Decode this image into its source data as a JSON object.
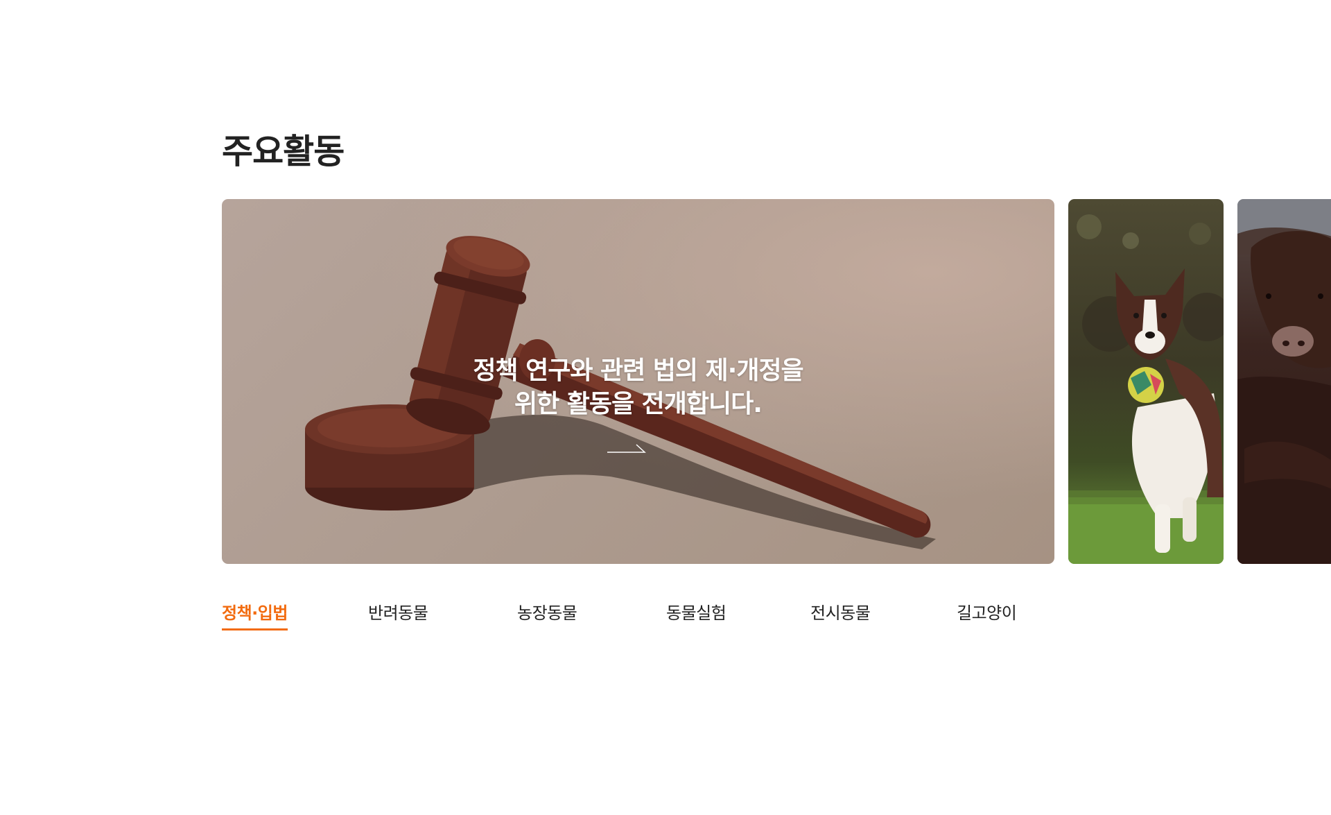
{
  "section": {
    "title": "주요활동"
  },
  "slides": [
    {
      "caption_line1": "정책 연구와 관련 법의 제·개정을",
      "caption_line2": "위한 활동을 전개합니다.",
      "image": "gavel-image"
    },
    {
      "image": "dog-image"
    },
    {
      "image": "cow-image"
    }
  ],
  "tabs": [
    {
      "label": "정책·입법",
      "active": true
    },
    {
      "label": "반려동물",
      "active": false
    },
    {
      "label": "농장동물",
      "active": false
    },
    {
      "label": "동물실험",
      "active": false
    },
    {
      "label": "전시동물",
      "active": false
    },
    {
      "label": "길고양이",
      "active": false
    }
  ],
  "colors": {
    "accent": "#f26b0f",
    "text": "#222222",
    "background": "#ffffff"
  },
  "icons": {
    "more": "arrow-right-icon"
  }
}
